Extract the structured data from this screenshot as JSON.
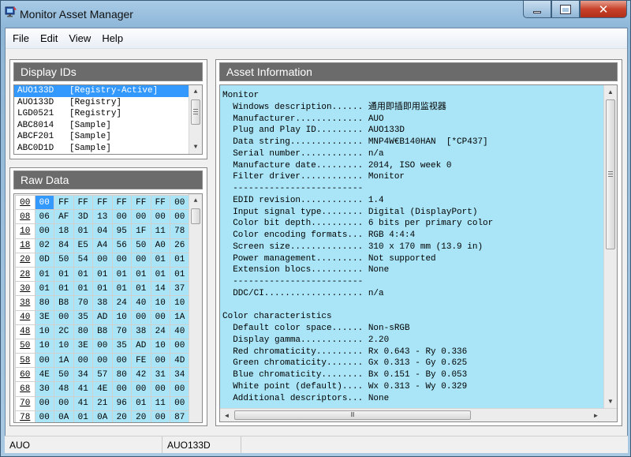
{
  "window": {
    "title": "Monitor Asset Manager",
    "controls": {
      "minimize": "minimize",
      "maximize": "maximize",
      "close": "✕"
    }
  },
  "menu": [
    "File",
    "Edit",
    "View",
    "Help"
  ],
  "display_ids": {
    "header": "Display IDs",
    "rows": [
      "AUO133D   [Registry-Active]",
      "AUO133D   [Registry]",
      "LGD0521   [Registry]",
      "ABC8014   [Sample]",
      "ABCF201   [Sample]",
      "ABC0D1D   [Sample]"
    ],
    "selected_index": 0
  },
  "raw_data": {
    "header": "Raw Data",
    "rows": [
      [
        "00",
        "00",
        "FF",
        "FF",
        "FF",
        "FF",
        "FF",
        "FF",
        "00"
      ],
      [
        "08",
        "06",
        "AF",
        "3D",
        "13",
        "00",
        "00",
        "00",
        "00"
      ],
      [
        "10",
        "00",
        "18",
        "01",
        "04",
        "95",
        "1F",
        "11",
        "78"
      ],
      [
        "18",
        "02",
        "84",
        "E5",
        "A4",
        "56",
        "50",
        "A0",
        "26"
      ],
      [
        "20",
        "0D",
        "50",
        "54",
        "00",
        "00",
        "00",
        "01",
        "01"
      ],
      [
        "28",
        "01",
        "01",
        "01",
        "01",
        "01",
        "01",
        "01",
        "01"
      ],
      [
        "30",
        "01",
        "01",
        "01",
        "01",
        "01",
        "01",
        "14",
        "37"
      ],
      [
        "38",
        "80",
        "B8",
        "70",
        "38",
        "24",
        "40",
        "10",
        "10"
      ],
      [
        "40",
        "3E",
        "00",
        "35",
        "AD",
        "10",
        "00",
        "00",
        "1A"
      ],
      [
        "48",
        "10",
        "2C",
        "80",
        "B8",
        "70",
        "38",
        "24",
        "40"
      ],
      [
        "50",
        "10",
        "10",
        "3E",
        "00",
        "35",
        "AD",
        "10",
        "00"
      ],
      [
        "58",
        "00",
        "1A",
        "00",
        "00",
        "00",
        "FE",
        "00",
        "4D"
      ],
      [
        "60",
        "4E",
        "50",
        "34",
        "57",
        "80",
        "42",
        "31",
        "34"
      ],
      [
        "68",
        "30",
        "48",
        "41",
        "4E",
        "00",
        "00",
        "00",
        "00"
      ],
      [
        "70",
        "00",
        "00",
        "41",
        "21",
        "96",
        "01",
        "11",
        "00"
      ],
      [
        "78",
        "00",
        "0A",
        "01",
        "0A",
        "20",
        "20",
        "00",
        "87"
      ]
    ]
  },
  "asset_info": {
    "header": "Asset Information",
    "lines": [
      "Monitor",
      "  Windows description...... 通用即插即用监视器",
      "  Manufacturer............. AUO",
      "  Plug and Play ID......... AUO133D",
      "  Data string.............. MNP4W€B140HAN  [*CP437]",
      "  Serial number............ n/a",
      "  Manufacture date......... 2014, ISO week 0",
      "  Filter driver............ Monitor",
      "  -------------------------",
      "  EDID revision............ 1.4",
      "  Input signal type........ Digital (DisplayPort)",
      "  Color bit depth.......... 6 bits per primary color",
      "  Color encoding formats... RGB 4:4:4",
      "  Screen size.............. 310 x 170 mm (13.9 in)",
      "  Power management......... Not supported",
      "  Extension blocs.......... None",
      "  -------------------------",
      "  DDC/CI................... n/a",
      "",
      "Color characteristics",
      "  Default color space...... Non-sRGB",
      "  Display gamma............ 2.20",
      "  Red chromaticity......... Rx 0.643 - Ry 0.336",
      "  Green chromaticity....... Gx 0.313 - Gy 0.625",
      "  Blue chromaticity........ Bx 0.151 - By 0.053",
      "  White point (default).... Wx 0.313 - Wy 0.329",
      "  Additional descriptors... None"
    ]
  },
  "status": {
    "left": "AUO",
    "right": "AUO133D"
  },
  "colors": {
    "accent": "#3399ff",
    "data_bg": "#a9e5f7",
    "panel_header": "#6b6b6b"
  },
  "icons": {
    "app": "monitor-app-icon",
    "scroll_up": "▲",
    "scroll_down": "▼",
    "scroll_left": "◄",
    "scroll_right": "►",
    "grip": "Ⅲ"
  }
}
